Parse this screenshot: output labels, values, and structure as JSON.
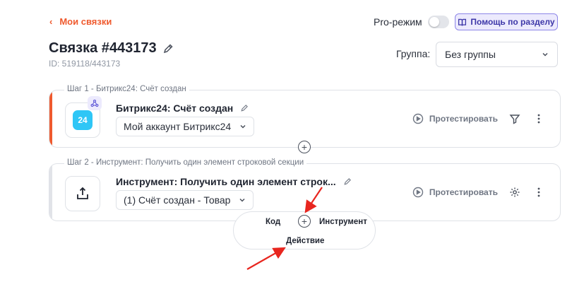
{
  "header": {
    "back_label": "Мои связки",
    "pro_mode_label": "Pro-режим",
    "pro_mode_on": false,
    "help_label": "Помощь по разделу",
    "title": "Связка #443173",
    "id_text": "ID: 519118/443173",
    "group_label": "Группа:",
    "group_value": "Без группы"
  },
  "steps": [
    {
      "legend": "Шаг 1 - Битрикс24: Счёт создан",
      "name": "Битрикс24: Счёт создан",
      "select_value": "Мой аккаунт Битрикс24",
      "app_icon_text": "24",
      "test_label": "Протестировать",
      "accent_color": "#ef5a2e"
    },
    {
      "legend": "Шаг 2 - Инструмент: Получить один элемент строковой секции",
      "name": "Инструмент: Получить один элемент строк...",
      "select_value": "(1) Счёт создан - Товар",
      "test_label": "Протестировать"
    }
  ],
  "add_menu": {
    "code_label": "Код",
    "tool_label": "Инструмент",
    "action_label": "Действие"
  },
  "colors": {
    "accent": "#ef5a2e",
    "help_bg": "#eceafd",
    "bitrix_blue": "#2fc6f6",
    "annotation_arrow": "#e8261f"
  },
  "icons": [
    "chevron-left-icon",
    "book-icon",
    "pencil-icon",
    "chevron-down-icon",
    "bitrix24-icon",
    "webhook-icon",
    "export-icon",
    "play-circle-icon",
    "filter-icon",
    "gear-icon",
    "more-vertical-icon",
    "plus-circle-icon"
  ]
}
